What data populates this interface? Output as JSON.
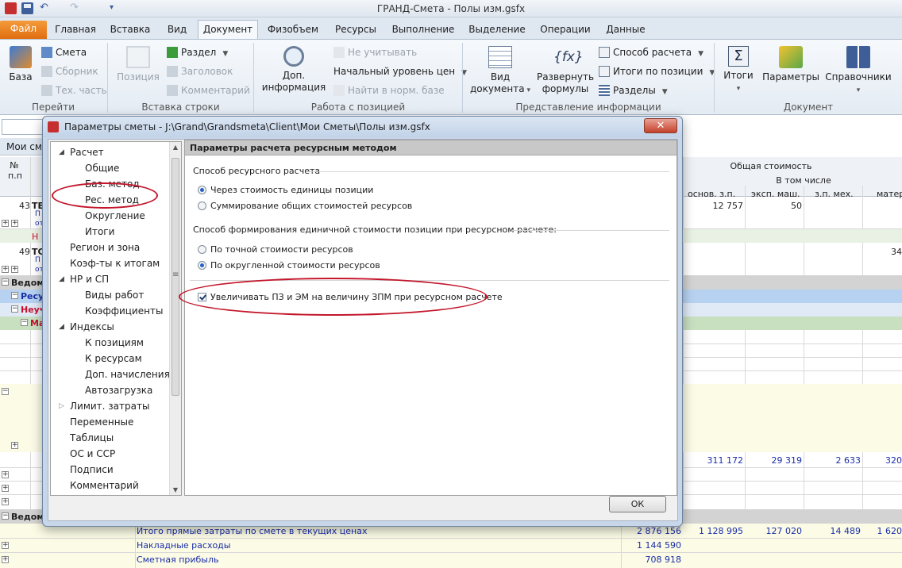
{
  "window": {
    "title": "ГРАНД-Смета - Полы изм.gsfx"
  },
  "ribbon_tabs": [
    {
      "label": "Файл"
    },
    {
      "label": "Главная"
    },
    {
      "label": "Вставка"
    },
    {
      "label": "Вид"
    },
    {
      "label": "Документ"
    },
    {
      "label": "Физобъем"
    },
    {
      "label": "Ресурсы"
    },
    {
      "label": "Выполнение"
    },
    {
      "label": "Выделение"
    },
    {
      "label": "Операции"
    },
    {
      "label": "Данные"
    }
  ],
  "ribbon": {
    "groups": {
      "go": "Перейти",
      "insert_row": "Вставка строки",
      "work_position": "Работа с позицией",
      "info_view": "Представление информации",
      "document": "Документ"
    },
    "go": {
      "base": "База",
      "estimate": "Смета",
      "collection": "Сборник",
      "tech_part": "Тех. часть"
    },
    "insert": {
      "position": "Позиция",
      "section": "Раздел",
      "header": "Заголовок",
      "comment": "Комментарий"
    },
    "work": {
      "info_line1": "Доп.",
      "info_line2": "информация",
      "ignore": "Не учитывать",
      "price_level": "Начальный уровень цен",
      "find_norm": "Найти в норм. базе"
    },
    "view": {
      "doc_view_line1": "Вид",
      "doc_view_line2": "документа",
      "formulas_line1": "Развернуть",
      "formulas_line2": "формулы",
      "calc_method": "Способ расчета",
      "totals_pos": "Итоги по позиции",
      "sections": "Разделы",
      "fx_glyph": "{fx}"
    },
    "document": {
      "totals": "Итоги",
      "params": "Параметры",
      "refs": "Справочники",
      "sigma": "Σ"
    }
  },
  "sheet": {
    "left_label": "Мои см",
    "col_num_line1": "№",
    "col_num_line2": "п.п",
    "total_cost": "Общая стоимость",
    "incl": "В том числе",
    "col_osn": "основ. з.п.",
    "col_eksp": "эксп. маш.",
    "col_zpmeh": "з.п. мех.",
    "col_mater": "матер",
    "row43_num": "43",
    "row43_tag": "ТЕ",
    "row43_sub1": "П",
    "row43_sub2": "от",
    "row43_osn": "12 757",
    "row43_eksp": "50",
    "row_h": "Н",
    "row49_num": "49",
    "row49_tag": "ТС",
    "row49_sub1": "П",
    "row49_sub2": "от",
    "row49_mat": "34",
    "ved1": "Ведом",
    "res": "Ресу",
    "neuch": "Неуч",
    "mat": "Ма",
    "sum_osn": "311 172",
    "sum_eksp": "29 319",
    "sum_zpmeh": "2 633",
    "sum_mat": "320",
    "ved2": "Ведом",
    "total_line": "Итого прямые затраты по смете в текущих ценах",
    "total_val": "2 876 156",
    "total_osn": "1 128 995",
    "total_eksp": "127 020",
    "total_zpmeh": "14 489",
    "total_mat": "1 620",
    "overhead": "Накладные расходы",
    "overhead_val": "1 144 590",
    "profit": "Сметная прибыль",
    "profit_val": "708 918"
  },
  "dialog": {
    "title": "Параметры сметы - J:\\Grand\\Grandsmeta\\Client\\Мои Сметы\\Полы изм.gsfx",
    "close": "✕",
    "tree": [
      {
        "label": "Расчет",
        "level": 0,
        "expander": "expanded"
      },
      {
        "label": "Общие",
        "level": 1
      },
      {
        "label": "Баз. метод",
        "level": 1
      },
      {
        "label": "Рес. метод",
        "level": 1
      },
      {
        "label": "Округление",
        "level": 1
      },
      {
        "label": "Итоги",
        "level": 1
      },
      {
        "label": "Регион и зона",
        "level": 0
      },
      {
        "label": "Коэф-ты к итогам",
        "level": 0
      },
      {
        "label": "НР и СП",
        "level": 0,
        "expander": "expanded"
      },
      {
        "label": "Виды работ",
        "level": 1
      },
      {
        "label": "Коэффициенты",
        "level": 1
      },
      {
        "label": "Индексы",
        "level": 0,
        "expander": "expanded"
      },
      {
        "label": "К позициям",
        "level": 1
      },
      {
        "label": "К ресурсам",
        "level": 1
      },
      {
        "label": "Доп. начисления",
        "level": 1
      },
      {
        "label": "Автозагрузка",
        "level": 1
      },
      {
        "label": "Лимит. затраты",
        "level": 0,
        "expander": "collapsed"
      },
      {
        "label": "Переменные",
        "level": 0
      },
      {
        "label": "Таблицы",
        "level": 0
      },
      {
        "label": "ОС и ССР",
        "level": 0
      },
      {
        "label": "Подписи",
        "level": 0
      },
      {
        "label": "Комментарий",
        "level": 0
      }
    ],
    "panel_title": "Параметры расчета ресурсным методом",
    "section1": "Способ ресурсного расчета",
    "opt1": "Через стоимость единицы позиции",
    "opt2": "Суммирование общих стоимостей ресурсов",
    "section2": "Способ формирования единичной стоимости позиции при ресурсном расчете:",
    "opt3": "По точной стоимости ресурсов",
    "opt4": "По округленной стоимости ресурсов",
    "checkbox_label": "Увеличивать ПЗ и ЭМ на величину ЗПМ при ресурсном расчете",
    "ok": "ОК",
    "tree_expanded_glyph": "◢",
    "tree_collapsed_glyph": "▷",
    "scroll_up": "▲",
    "scroll_down": "▼",
    "scroll_grip": "≡"
  },
  "qat": {
    "undo": "↶",
    "redo": "↷",
    "menu": "▾"
  },
  "colors": {
    "accent_red": "#c3172b",
    "file_tab": "#e06d10",
    "selected_blue": "#2561c7"
  }
}
